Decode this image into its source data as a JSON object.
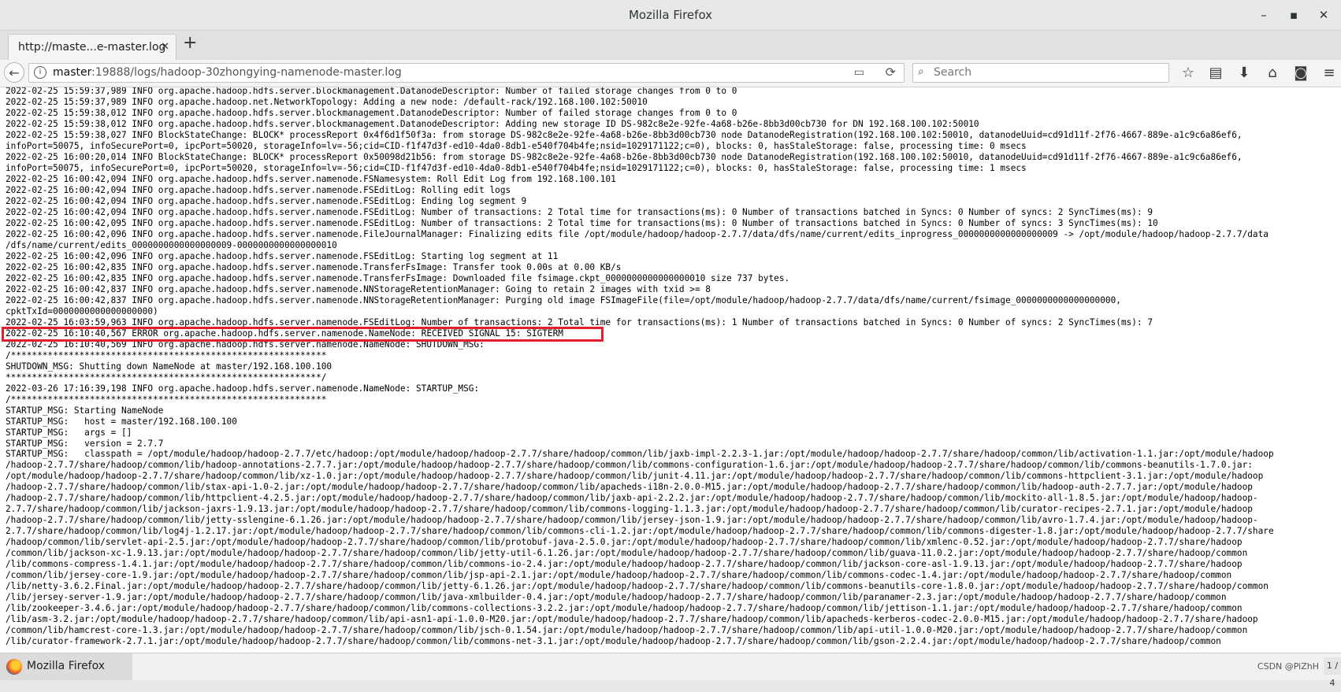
{
  "window": {
    "title": "Mozilla Firefox",
    "minimize_label": "–",
    "maximize_label": "▪",
    "close_label": "✕"
  },
  "tabs": [
    {
      "label": "http://maste...e-master.log",
      "close_label": "✕"
    }
  ],
  "new_tab_label": "+",
  "navbar": {
    "back_glyph": "←",
    "info_glyph": "i",
    "url_host": "master",
    "url_rest": ":19888/logs/hadoop-30zhongying-namenode-master.log",
    "reader_glyph": "▭",
    "reload_glyph": "⟳",
    "search_glyph": "⌕",
    "search_placeholder": "Search"
  },
  "toolbar_icons": [
    {
      "name": "bookmark-star-icon",
      "glyph": "☆"
    },
    {
      "name": "bookmarks-library-icon",
      "glyph": "▤"
    },
    {
      "name": "downloads-icon",
      "glyph": "⬇"
    },
    {
      "name": "home-icon",
      "glyph": "⌂"
    },
    {
      "name": "pocket-icon",
      "glyph": "◙"
    },
    {
      "name": "menu-icon",
      "glyph": "≡"
    }
  ],
  "log": {
    "lines_before_error": "2022-02-25 15:59:37,989 INFO org.apache.hadoop.hdfs.server.blockmanagement.DatanodeDescriptor: Number of failed storage changes from 0 to 0\n2022-02-25 15:59:37,989 INFO org.apache.hadoop.net.NetworkTopology: Adding a new node: /default-rack/192.168.100.102:50010\n2022-02-25 15:59:38,012 INFO org.apache.hadoop.hdfs.server.blockmanagement.DatanodeDescriptor: Number of failed storage changes from 0 to 0\n2022-02-25 15:59:38,012 INFO org.apache.hadoop.hdfs.server.blockmanagement.DatanodeDescriptor: Adding new storage ID DS-982c8e2e-92fe-4a68-b26e-8bb3d00cb730 for DN 192.168.100.102:50010\n2022-02-25 15:59:38,027 INFO BlockStateChange: BLOCK* processReport 0x4f6d1f50f3a: from storage DS-982c8e2e-92fe-4a68-b26e-8bb3d00cb730 node DatanodeRegistration(192.168.100.102:50010, datanodeUuid=cd91d11f-2f76-4667-889e-a1c9c6a86ef6,\ninfoPort=50075, infoSecurePort=0, ipcPort=50020, storageInfo=lv=-56;cid=CID-f1f47d3f-ed10-4da0-8db1-e540f704b4fe;nsid=1029171122;c=0), blocks: 0, hasStaleStorage: false, processing time: 0 msecs\n2022-02-25 16:00:20,014 INFO BlockStateChange: BLOCK* processReport 0x50098d21b56: from storage DS-982c8e2e-92fe-4a68-b26e-8bb3d00cb730 node DatanodeRegistration(192.168.100.102:50010, datanodeUuid=cd91d11f-2f76-4667-889e-a1c9c6a86ef6,\ninfoPort=50075, infoSecurePort=0, ipcPort=50020, storageInfo=lv=-56;cid=CID-f1f47d3f-ed10-4da0-8db1-e540f704b4fe;nsid=1029171122;c=0), blocks: 0, hasStaleStorage: false, processing time: 1 msecs\n2022-02-25 16:00:42,094 INFO org.apache.hadoop.hdfs.server.namenode.FSNamesystem: Roll Edit Log from 192.168.100.101\n2022-02-25 16:00:42,094 INFO org.apache.hadoop.hdfs.server.namenode.FSEditLog: Rolling edit logs\n2022-02-25 16:00:42,094 INFO org.apache.hadoop.hdfs.server.namenode.FSEditLog: Ending log segment 9\n2022-02-25 16:00:42,094 INFO org.apache.hadoop.hdfs.server.namenode.FSEditLog: Number of transactions: 2 Total time for transactions(ms): 0 Number of transactions batched in Syncs: 0 Number of syncs: 2 SyncTimes(ms): 9\n2022-02-25 16:00:42,095 INFO org.apache.hadoop.hdfs.server.namenode.FSEditLog: Number of transactions: 2 Total time for transactions(ms): 0 Number of transactions batched in Syncs: 0 Number of syncs: 3 SyncTimes(ms): 10\n2022-02-25 16:00:42,096 INFO org.apache.hadoop.hdfs.server.namenode.FileJournalManager: Finalizing edits file /opt/module/hadoop/hadoop-2.7.7/data/dfs/name/current/edits_inprogress_0000000000000000009 -> /opt/module/hadoop/hadoop-2.7.7/data\n/dfs/name/current/edits_0000000000000000009-0000000000000000010\n2022-02-25 16:00:42,096 INFO org.apache.hadoop.hdfs.server.namenode.FSEditLog: Starting log segment at 11\n2022-02-25 16:00:42,835 INFO org.apache.hadoop.hdfs.server.namenode.TransferFsImage: Transfer took 0.00s at 0.00 KB/s\n2022-02-25 16:00:42,835 INFO org.apache.hadoop.hdfs.server.namenode.TransferFsImage: Downloaded file fsimage.ckpt_0000000000000000010 size 737 bytes.\n2022-02-25 16:00:42,837 INFO org.apache.hadoop.hdfs.server.namenode.NNStorageRetentionManager: Going to retain 2 images with txid >= 8\n2022-02-25 16:00:42,837 INFO org.apache.hadoop.hdfs.server.namenode.NNStorageRetentionManager: Purging old image FSImageFile(file=/opt/module/hadoop/hadoop-2.7.7/data/dfs/name/current/fsimage_0000000000000000000,\ncpktTxId=0000000000000000000)\n2022-02-25 16:03:59,963 INFO org.apache.hadoop.hdfs.server.namenode.FSEditLog: Number of transactions: 2 Total time for transactions(ms): 1 Number of transactions batched in Syncs: 0 Number of syncs: 2 SyncTimes(ms): 7",
    "error_line": "2022-02-25 16:10:40,567 ERROR org.apache.hadoop.hdfs.server.namenode.NameNode: RECEIVED SIGNAL 15: SIGTERM",
    "lines_after_error": "2022-02-25 16:10:40,569 INFO org.apache.hadoop.hdfs.server.namenode.NameNode: SHUTDOWN_MSG:\n/************************************************************\nSHUTDOWN_MSG: Shutting down NameNode at master/192.168.100.100\n************************************************************/\n2022-03-26 17:16:39,198 INFO org.apache.hadoop.hdfs.server.namenode.NameNode: STARTUP_MSG:\n/************************************************************\nSTARTUP_MSG: Starting NameNode\nSTARTUP_MSG:   host = master/192.168.100.100\nSTARTUP_MSG:   args = []\nSTARTUP_MSG:   version = 2.7.7\nSTARTUP_MSG:   classpath = /opt/module/hadoop/hadoop-2.7.7/etc/hadoop:/opt/module/hadoop/hadoop-2.7.7/share/hadoop/common/lib/jaxb-impl-2.2.3-1.jar:/opt/module/hadoop/hadoop-2.7.7/share/hadoop/common/lib/activation-1.1.jar:/opt/module/hadoop\n/hadoop-2.7.7/share/hadoop/common/lib/hadoop-annotations-2.7.7.jar:/opt/module/hadoop/hadoop-2.7.7/share/hadoop/common/lib/commons-configuration-1.6.jar:/opt/module/hadoop/hadoop-2.7.7/share/hadoop/common/lib/commons-beanutils-1.7.0.jar:\n/opt/module/hadoop/hadoop-2.7.7/share/hadoop/common/lib/xz-1.0.jar:/opt/module/hadoop/hadoop-2.7.7/share/hadoop/common/lib/junit-4.11.jar:/opt/module/hadoop/hadoop-2.7.7/share/hadoop/common/lib/commons-httpclient-3.1.jar:/opt/module/hadoop\n/hadoop-2.7.7/share/hadoop/common/lib/stax-api-1.0-2.jar:/opt/module/hadoop/hadoop-2.7.7/share/hadoop/common/lib/apacheds-i18n-2.0.0-M15.jar:/opt/module/hadoop/hadoop-2.7.7/share/hadoop/common/lib/hadoop-auth-2.7.7.jar:/opt/module/hadoop\n/hadoop-2.7.7/share/hadoop/common/lib/httpclient-4.2.5.jar:/opt/module/hadoop/hadoop-2.7.7/share/hadoop/common/lib/jaxb-api-2.2.2.jar:/opt/module/hadoop/hadoop-2.7.7/share/hadoop/common/lib/mockito-all-1.8.5.jar:/opt/module/hadoop/hadoop-\n2.7.7/share/hadoop/common/lib/jackson-jaxrs-1.9.13.jar:/opt/module/hadoop/hadoop-2.7.7/share/hadoop/common/lib/commons-logging-1.1.3.jar:/opt/module/hadoop/hadoop-2.7.7/share/hadoop/common/lib/curator-recipes-2.7.1.jar:/opt/module/hadoop\n/hadoop-2.7.7/share/hadoop/common/lib/jetty-sslengine-6.1.26.jar:/opt/module/hadoop/hadoop-2.7.7/share/hadoop/common/lib/jersey-json-1.9.jar:/opt/module/hadoop/hadoop-2.7.7/share/hadoop/common/lib/avro-1.7.4.jar:/opt/module/hadoop/hadoop-\n2.7.7/share/hadoop/common/lib/log4j-1.2.17.jar:/opt/module/hadoop/hadoop-2.7.7/share/hadoop/common/lib/commons-cli-1.2.jar:/opt/module/hadoop/hadoop-2.7.7/share/hadoop/common/lib/commons-digester-1.8.jar:/opt/module/hadoop/hadoop-2.7.7/share\n/hadoop/common/lib/servlet-api-2.5.jar:/opt/module/hadoop/hadoop-2.7.7/share/hadoop/common/lib/protobuf-java-2.5.0.jar:/opt/module/hadoop/hadoop-2.7.7/share/hadoop/common/lib/xmlenc-0.52.jar:/opt/module/hadoop/hadoop-2.7.7/share/hadoop\n/common/lib/jackson-xc-1.9.13.jar:/opt/module/hadoop/hadoop-2.7.7/share/hadoop/common/lib/jetty-util-6.1.26.jar:/opt/module/hadoop/hadoop-2.7.7/share/hadoop/common/lib/guava-11.0.2.jar:/opt/module/hadoop/hadoop-2.7.7/share/hadoop/common\n/lib/commons-compress-1.4.1.jar:/opt/module/hadoop/hadoop-2.7.7/share/hadoop/common/lib/commons-io-2.4.jar:/opt/module/hadoop/hadoop-2.7.7/share/hadoop/common/lib/jackson-core-asl-1.9.13.jar:/opt/module/hadoop/hadoop-2.7.7/share/hadoop\n/common/lib/jersey-core-1.9.jar:/opt/module/hadoop/hadoop-2.7.7/share/hadoop/common/lib/jsp-api-2.1.jar:/opt/module/hadoop/hadoop-2.7.7/share/hadoop/common/lib/commons-codec-1.4.jar:/opt/module/hadoop/hadoop-2.7.7/share/hadoop/common\n/lib/netty-3.6.2.Final.jar:/opt/module/hadoop/hadoop-2.7.7/share/hadoop/common/lib/jetty-6.1.26.jar:/opt/module/hadoop/hadoop-2.7.7/share/hadoop/common/lib/commons-beanutils-core-1.8.0.jar:/opt/module/hadoop/hadoop-2.7.7/share/hadoop/common\n/lib/jersey-server-1.9.jar:/opt/module/hadoop/hadoop-2.7.7/share/hadoop/common/lib/java-xmlbuilder-0.4.jar:/opt/module/hadoop/hadoop-2.7.7/share/hadoop/common/lib/paranamer-2.3.jar:/opt/module/hadoop/hadoop-2.7.7/share/hadoop/common\n/lib/zookeeper-3.4.6.jar:/opt/module/hadoop/hadoop-2.7.7/share/hadoop/common/lib/commons-collections-3.2.2.jar:/opt/module/hadoop/hadoop-2.7.7/share/hadoop/common/lib/jettison-1.1.jar:/opt/module/hadoop/hadoop-2.7.7/share/hadoop/common\n/lib/asm-3.2.jar:/opt/module/hadoop/hadoop-2.7.7/share/hadoop/common/lib/api-asn1-api-1.0.0-M20.jar:/opt/module/hadoop/hadoop-2.7.7/share/hadoop/common/lib/apacheds-kerberos-codec-2.0.0-M15.jar:/opt/module/hadoop/hadoop-2.7.7/share/hadoop\n/common/lib/hamcrest-core-1.3.jar:/opt/module/hadoop/hadoop-2.7.7/share/hadoop/common/lib/jsch-0.1.54.jar:/opt/module/hadoop/hadoop-2.7.7/share/hadoop/common/lib/api-util-1.0.0-M20.jar:/opt/module/hadoop/hadoop-2.7.7/share/hadoop/common\n/lib/curator-framework-2.7.1.jar:/opt/module/hadoop/hadoop-2.7.7/share/hadoop/common/lib/commons-net-3.1.jar:/opt/module/hadoop/hadoop-2.7.7/share/hadoop/common/lib/gson-2.2.4.jar:/opt/module/hadoop/hadoop-2.7.7/share/hadoop/common"
  },
  "highlight_color": "#e0212d",
  "taskbar": {
    "app_label": "Mozilla Firefox",
    "watermark": "CSDN @PiZhH",
    "pager": "1 / 4"
  }
}
